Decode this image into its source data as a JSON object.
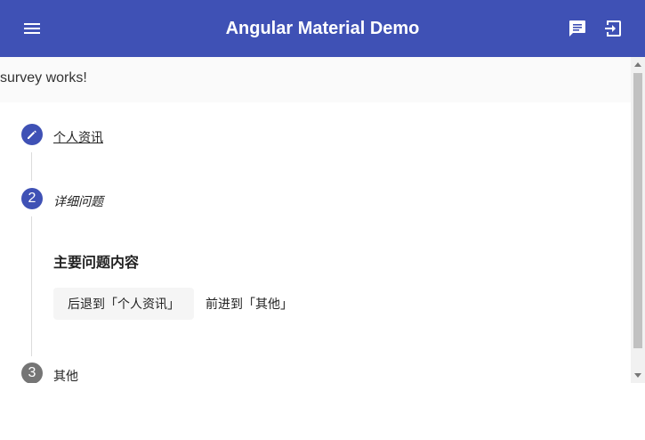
{
  "app": {
    "title": "Angular Material Demo"
  },
  "toolbar": {
    "menu_icon": "menu-icon",
    "chat_icon": "chat-icon",
    "logout_icon": "logout-icon"
  },
  "page": {
    "banner_text": "survey works!"
  },
  "stepper": {
    "steps": [
      {
        "label": "个人资讯",
        "icon": "edit-icon",
        "state": "done"
      },
      {
        "label": "详细问题",
        "number": "2",
        "state": "active"
      },
      {
        "label": "其他",
        "number": "3",
        "state": "pending"
      }
    ],
    "content_title": "主要问题内容",
    "back_button": "后退到「个人资讯」",
    "next_button": "前进到「其他」"
  },
  "colors": {
    "primary": "#3f51b5",
    "inactive_step": "#757575"
  }
}
